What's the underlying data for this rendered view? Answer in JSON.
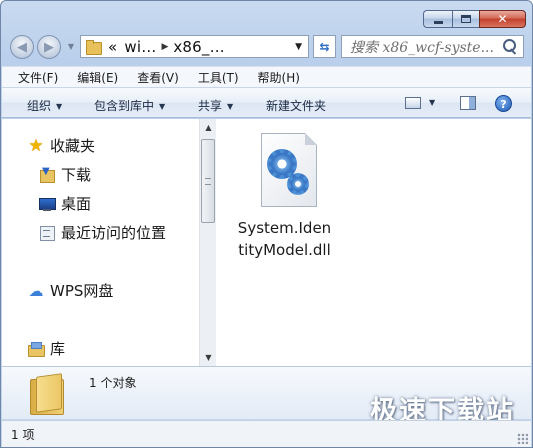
{
  "window": {
    "caption": {
      "minimize_icon": "minimize-icon",
      "maximize_icon": "maximize-icon",
      "close_glyph": "✕"
    }
  },
  "nav": {
    "address_parts": [
      "«",
      "wi…",
      "x86_…"
    ],
    "search_placeholder": "搜索 x86_wcf-syste..."
  },
  "menu": [
    "文件(F)",
    "编辑(E)",
    "查看(V)",
    "工具(T)",
    "帮助(H)"
  ],
  "commands": {
    "organize": "组织",
    "include_in_library": "包含到库中",
    "share": "共享",
    "new_folder": "新建文件夹"
  },
  "sidebar": {
    "favorites": "收藏夹",
    "downloads": "下载",
    "desktop": "桌面",
    "recent_places": "最近访问的位置",
    "wps_cloud": "WPS网盘",
    "libraries": "库"
  },
  "files": [
    {
      "name": "System.IdentityModel.dll",
      "icon": "dll-gear-icon"
    }
  ],
  "details": {
    "count": "1 个对象",
    "watermark": "极速下载站"
  },
  "status": {
    "items": "1 项"
  },
  "colors": {
    "frame": "#c3d6ee",
    "close": "#c2412c",
    "accent": "#2d6ec2"
  }
}
